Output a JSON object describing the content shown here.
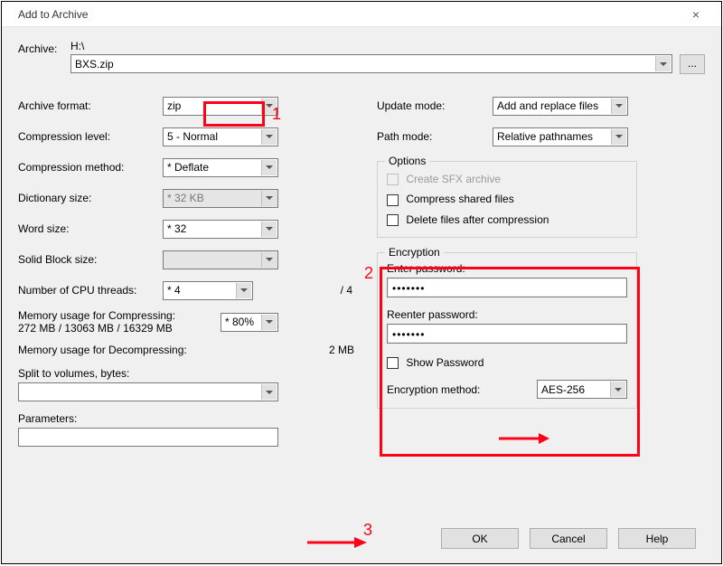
{
  "window": {
    "title": "Add to Archive",
    "close": "×"
  },
  "archive": {
    "label": "Archive:",
    "path_prefix": "H:\\",
    "filename": "BXS.zip",
    "browse": "..."
  },
  "left": {
    "format_label": "Archive format:",
    "format_value": "zip",
    "level_label": "Compression level:",
    "level_value": "5 - Normal",
    "method_label": "Compression method:",
    "method_value": "* Deflate",
    "dict_label": "Dictionary size:",
    "dict_value": "* 32 KB",
    "word_label": "Word size:",
    "word_value": "* 32",
    "solid_label": "Solid Block size:",
    "threads_label": "Number of CPU threads:",
    "threads_value": "* 4",
    "threads_total": "/ 4",
    "mem_compress_label": "Memory usage for Compressing:",
    "mem_compress_info": "272 MB / 13063 MB / 16329 MB",
    "mem_compress_pct": "* 80%",
    "mem_decompress_label": "Memory usage for Decompressing:",
    "mem_decompress_value": "2 MB",
    "split_label": "Split to volumes, bytes:",
    "params_label": "Parameters:"
  },
  "right": {
    "update_label": "Update mode:",
    "update_value": "Add and replace files",
    "path_label": "Path mode:",
    "path_value": "Relative pathnames",
    "options_legend": "Options",
    "opt_sfx": "Create SFX archive",
    "opt_shared": "Compress shared files",
    "opt_delete": "Delete files after compression",
    "enc_legend": "Encryption",
    "enter_pw_label": "Enter password:",
    "pw_value": "•••••••",
    "reenter_pw_label": "Reenter password:",
    "repw_value": "•••••••",
    "show_pw": "Show Password",
    "enc_method_label": "Encryption method:",
    "enc_method_value": "AES-256"
  },
  "buttons": {
    "ok": "OK",
    "cancel": "Cancel",
    "help": "Help"
  },
  "anno": {
    "n1": "1",
    "n2": "2",
    "n3": "3"
  }
}
